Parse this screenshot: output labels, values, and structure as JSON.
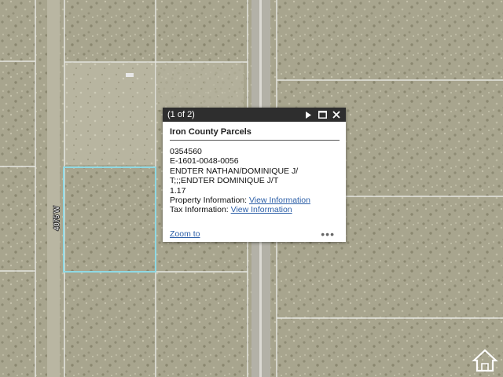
{
  "map": {
    "road_label": "4075 W",
    "selection_color": "#8fd9e4"
  },
  "popup": {
    "count": "(1 of 2)",
    "title": "Iron County Parcels",
    "lines": [
      "0354560",
      "E-1601-0048-0056",
      "ENDTER NATHAN/DOMINIQUE J/",
      "T;;;ENDTER DOMINIQUE J/T",
      "1.17"
    ],
    "property_label": "Property Information:",
    "property_link": "View Information",
    "tax_label": "Tax Information:",
    "tax_link": "View Information",
    "zoom_link": "Zoom to",
    "more": "•••",
    "icons": [
      "play-icon",
      "maximize-icon",
      "close-icon",
      "more-icon"
    ]
  }
}
